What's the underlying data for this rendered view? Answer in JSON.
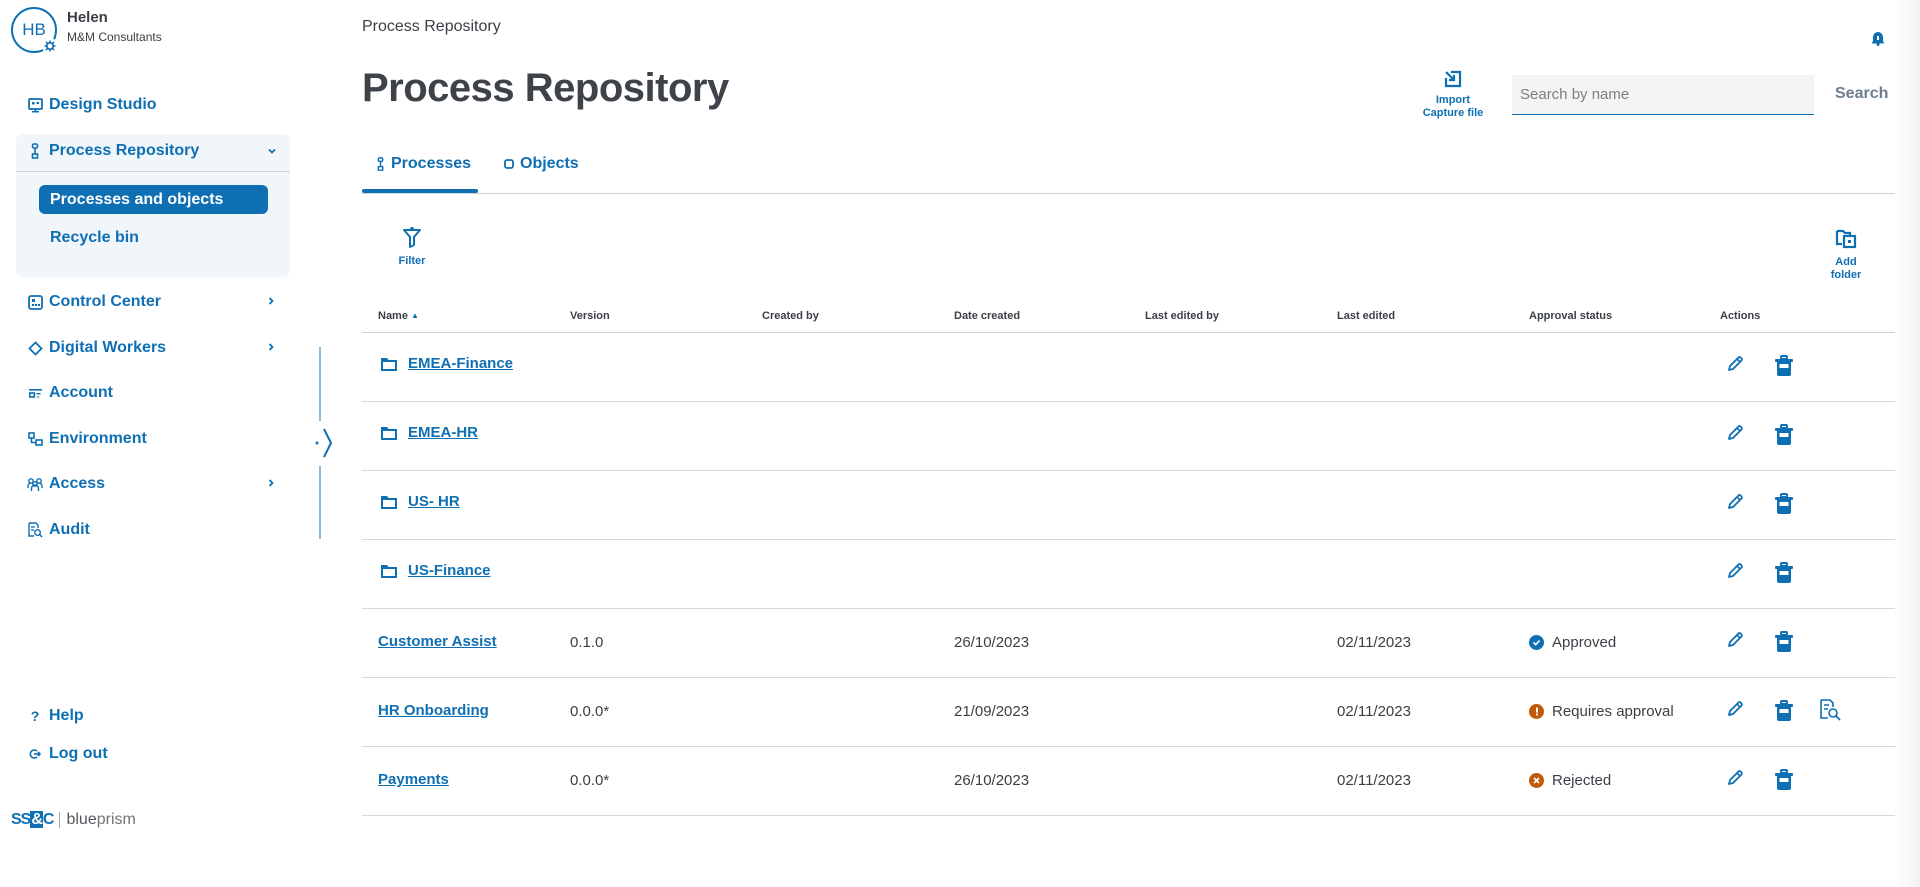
{
  "user": {
    "initials": "HB",
    "name": "Helen",
    "org": "M&M Consultants"
  },
  "sidebar": {
    "items": [
      {
        "label": "Design Studio",
        "icon": "monitor-icon"
      },
      {
        "label": "Process Repository",
        "icon": "process-icon",
        "expanded": true,
        "children": [
          {
            "label": "Processes and objects",
            "active": true
          },
          {
            "label": "Recycle bin"
          }
        ]
      },
      {
        "label": "Control Center",
        "icon": "dashboard-icon",
        "has_submenu": true
      },
      {
        "label": "Digital Workers",
        "icon": "diamond-icon",
        "has_submenu": true
      },
      {
        "label": "Account",
        "icon": "account-icon"
      },
      {
        "label": "Environment",
        "icon": "environment-icon"
      },
      {
        "label": "Access",
        "icon": "users-icon",
        "has_submenu": true
      },
      {
        "label": "Audit",
        "icon": "audit-icon"
      }
    ],
    "footer": [
      {
        "label": "Help",
        "icon": "help-icon"
      },
      {
        "label": "Log out",
        "icon": "logout-icon"
      }
    ],
    "logo": {
      "brand_a": "SS",
      "brand_amp": "&",
      "brand_c": "C",
      "brand_b1": "blue",
      "brand_b2": "prism"
    }
  },
  "header": {
    "breadcrumb": "Process Repository",
    "title": "Process Repository",
    "import_label_1": "Import",
    "import_label_2": "Capture file",
    "search_placeholder": "Search by name",
    "search_value": "",
    "search_button": "Search"
  },
  "tabs": [
    {
      "label": "Processes",
      "icon": "process-icon",
      "active": true
    },
    {
      "label": "Objects",
      "icon": "object-icon",
      "active": false
    }
  ],
  "toolbar": {
    "filter_label": "Filter",
    "add_folder_1": "Add",
    "add_folder_2": "folder"
  },
  "table": {
    "columns": [
      "Name",
      "Version",
      "Created by",
      "Date created",
      "Last edited by",
      "Last edited",
      "Approval status",
      "Actions"
    ],
    "sort": {
      "column": "Name",
      "direction": "ascending"
    },
    "folders": [
      {
        "name": "EMEA-Finance"
      },
      {
        "name": "EMEA-HR"
      },
      {
        "name": "US- HR"
      },
      {
        "name": "US-Finance"
      }
    ],
    "processes": [
      {
        "name": "Customer Assist",
        "version": "0.1.0",
        "created_by": "",
        "date_created": "26/10/2023",
        "last_edited_by": "",
        "last_edited": "02/11/2023",
        "status": "Approved",
        "status_type": "approved",
        "review": false
      },
      {
        "name": "HR Onboarding",
        "version": "0.0.0*",
        "created_by": "",
        "date_created": "21/09/2023",
        "last_edited_by": "",
        "last_edited": "02/11/2023",
        "status": "Requires approval",
        "status_type": "pending",
        "review": true
      },
      {
        "name": "Payments",
        "version": "0.0.0*",
        "created_by": "",
        "date_created": "26/10/2023",
        "last_edited_by": "",
        "last_edited": "02/11/2023",
        "status": "Rejected",
        "status_type": "rejected",
        "review": false
      }
    ]
  },
  "colors": {
    "primary": "#0f6fb3",
    "warning": "#c25a0c",
    "text": "#3a3f45",
    "panel": "#f1f6fb"
  }
}
